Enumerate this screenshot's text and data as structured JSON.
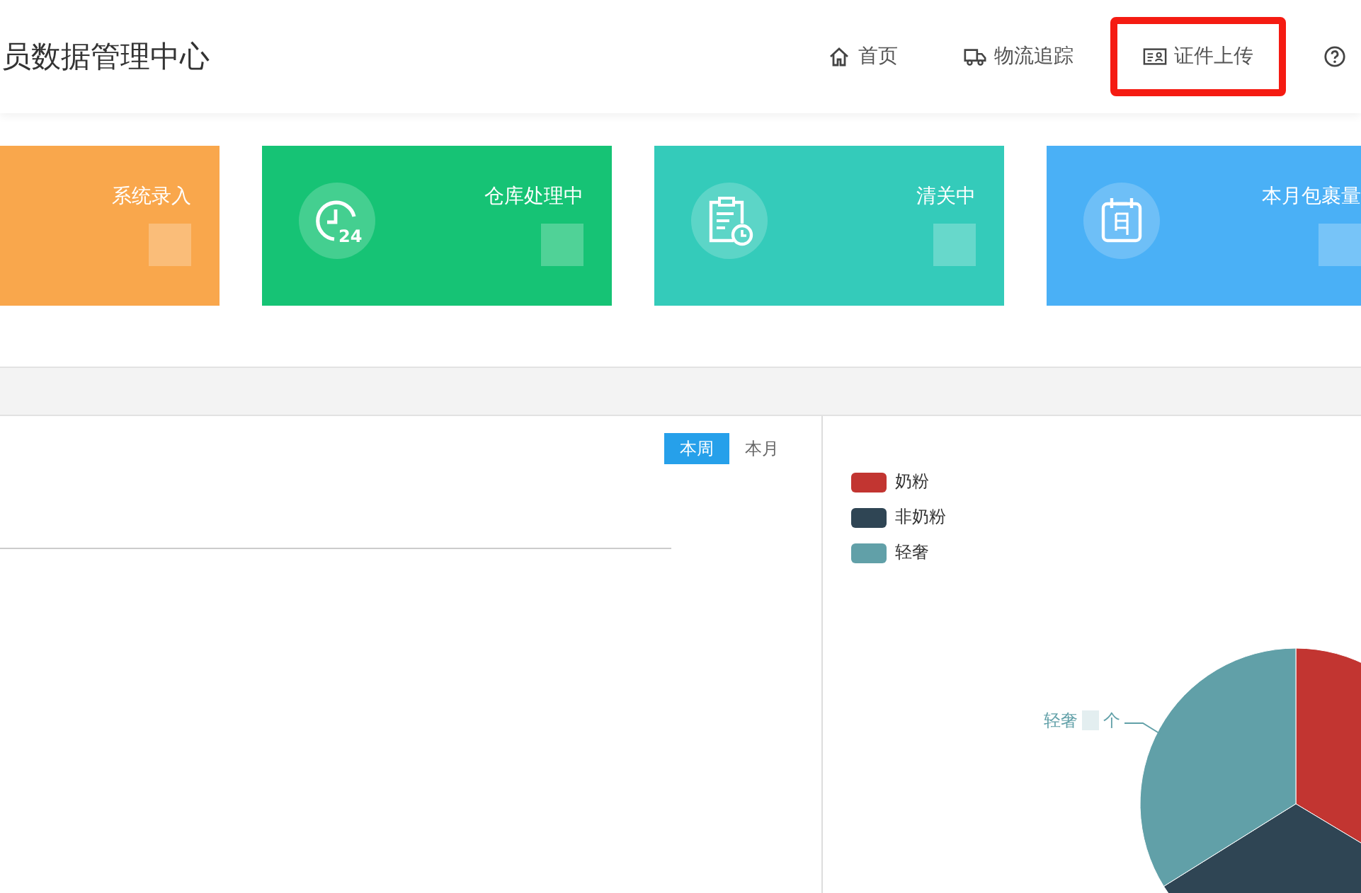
{
  "header": {
    "title": "员数据管理中心",
    "nav": [
      {
        "label": "首页",
        "kind": "home",
        "highlighted": false
      },
      {
        "label": "物流追踪",
        "kind": "truck",
        "highlighted": false
      },
      {
        "label": "证件上传",
        "kind": "id",
        "highlighted": true
      },
      {
        "kind": "help",
        "highlighted": false
      }
    ]
  },
  "cards": [
    {
      "label": "系统录入",
      "kind": "none",
      "color": "#f9a74c"
    },
    {
      "label": "仓库处理中",
      "kind": "clock",
      "color": "#16c375",
      "icon_text": "24"
    },
    {
      "label": "清关中",
      "kind": "clipboard",
      "color": "#34cbba"
    },
    {
      "label": "本月包裹量",
      "kind": "calendar",
      "color": "#4ab0f6"
    }
  ],
  "period_tabs": [
    {
      "label": "本周",
      "selected": true
    },
    {
      "label": "本月",
      "selected": false
    }
  ],
  "legend": [
    {
      "label": "奶粉",
      "color": "#c23531"
    },
    {
      "label": "非奶粉",
      "color": "#2f4554"
    },
    {
      "label": "轻奢",
      "color": "#61a0a8"
    }
  ],
  "pie_label": {
    "name": "轻奢",
    "unit": "个"
  }
}
